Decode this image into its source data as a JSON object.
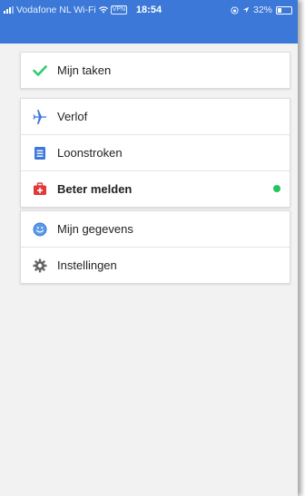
{
  "status_bar": {
    "carrier": "Vodafone NL Wi-Fi",
    "vpn": "VPN",
    "time": "18:54",
    "battery": "32%"
  },
  "menu": {
    "section1": [
      {
        "label": "Mijn taken",
        "icon": "check-icon",
        "color": "#2ecc71"
      }
    ],
    "section2": [
      {
        "label": "Verlof",
        "icon": "airplane-icon",
        "color": "#3b78d8"
      },
      {
        "label": "Loonstroken",
        "icon": "document-icon",
        "color": "#3b78d8"
      },
      {
        "label": "Beter melden",
        "icon": "medical-kit-icon",
        "color": "#e03b3b",
        "bold": true,
        "indicator_color": "#22c55e"
      }
    ],
    "section3": [
      {
        "label": "Mijn gegevens",
        "icon": "smiley-icon",
        "color": "#3b78d8"
      },
      {
        "label": "Instellingen",
        "icon": "gear-icon",
        "color": "#666666"
      }
    ]
  },
  "colors": {
    "header": "#3b78d8",
    "background": "#f2f2f3"
  }
}
